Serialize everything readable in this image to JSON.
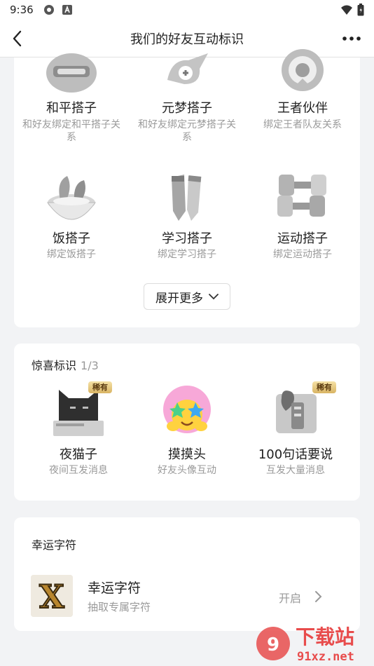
{
  "status_bar": {
    "time": "9:36"
  },
  "nav": {
    "title": "我们的好友互动标识"
  },
  "partners": {
    "items": [
      {
        "name": "和平搭子",
        "desc": "和好友绑定和平搭子关系"
      },
      {
        "name": "元梦搭子",
        "desc": "和好友绑定元梦搭子关系"
      },
      {
        "name": "王者伙伴",
        "desc": "绑定王者队友关系"
      },
      {
        "name": "饭搭子",
        "desc": "绑定饭搭子"
      },
      {
        "name": "学习搭子",
        "desc": "绑定学习搭子"
      },
      {
        "name": "运动搭子",
        "desc": "绑定运动搭子"
      }
    ],
    "expand_label": "展开更多"
  },
  "surprise": {
    "title": "惊喜标识",
    "count": "1/3",
    "items": [
      {
        "name": "夜猫子",
        "desc": "夜间互发消息",
        "badge": "稀有"
      },
      {
        "name": "摸摸头",
        "desc": "好友头像互动",
        "badge": ""
      },
      {
        "name": "100句话要说",
        "desc": "互发大量消息",
        "badge": "稀有"
      }
    ]
  },
  "lucky": {
    "title": "幸运字符",
    "item_name": "幸运字符",
    "item_desc": "抽取专属字符",
    "action": "开启",
    "thumb_letter": "X"
  },
  "watermark": {
    "text_main": "下载站",
    "text_sub": "91xz.net"
  }
}
